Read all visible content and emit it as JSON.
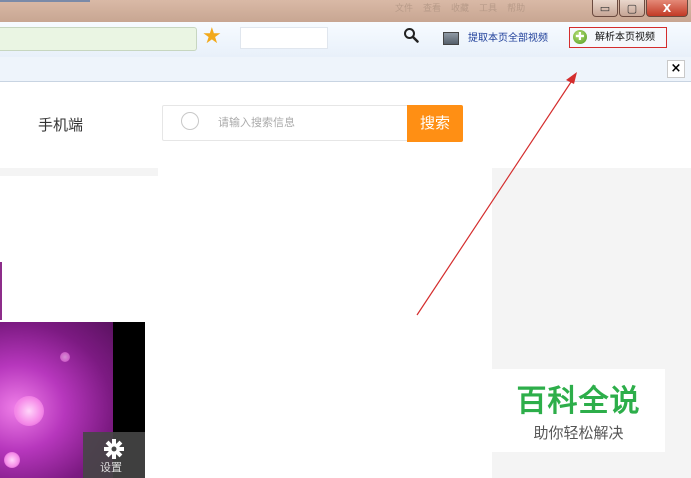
{
  "titlebar": {
    "menu": [
      "文件",
      "查看",
      "收藏",
      "工具",
      "帮助"
    ],
    "buttons": {
      "minimize": "▭",
      "maximize": "▢",
      "close": "X"
    }
  },
  "toolbar": {
    "grab_all_label": "提取本页全部视频",
    "parse_label": "解析本页视频",
    "parse_icon_glyph": "✚",
    "star_glyph": "★",
    "search_glyph": "🔍"
  },
  "notification": {
    "close_glyph": "×"
  },
  "page": {
    "mobile_link": "手机端",
    "search": {
      "placeholder": "请输入搜索信息",
      "button": "搜索"
    },
    "video": {
      "settings_label": "设置",
      "settings_glyph": "✿"
    }
  },
  "watermark": {
    "title": "百科全说",
    "subtitle": "助你轻松解决"
  },
  "colors": {
    "accent_orange": "#ff8f14",
    "watermark_green": "#2dae4a",
    "annotation_red": "#d42d2d"
  }
}
